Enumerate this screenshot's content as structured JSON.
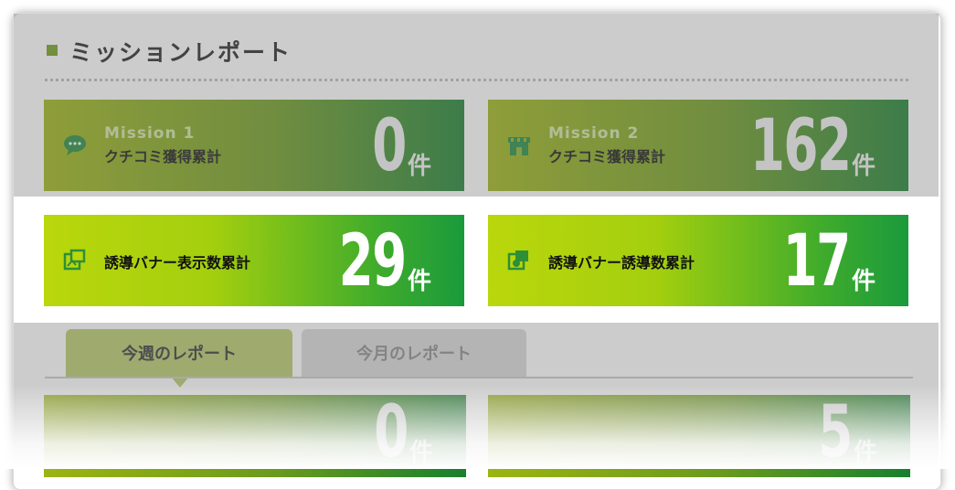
{
  "header": {
    "title": "ミッションレポート"
  },
  "missions": [
    {
      "label": "Mission 1",
      "sub": "クチコミ獲得累計",
      "value": "0",
      "unit": "件",
      "icon": "speech-bubble-icon"
    },
    {
      "label": "Mission 2",
      "sub": "クチコミ獲得累計",
      "value": "162",
      "unit": "件",
      "icon": "store-icon"
    }
  ],
  "banners": [
    {
      "sub": "誘導バナー表示数累計",
      "value": "29",
      "unit": "件",
      "icon": "banner-display-icon"
    },
    {
      "sub": "誘導バナー誘導数累計",
      "value": "17",
      "unit": "件",
      "icon": "banner-click-icon"
    }
  ],
  "tabs": [
    {
      "label": "今週のレポート",
      "active": true
    },
    {
      "label": "今月のレポート",
      "active": false
    }
  ],
  "lower": [
    {
      "value": "0",
      "unit": "件"
    },
    {
      "value": "5",
      "unit": "件"
    }
  ],
  "colors": {
    "accent": "#6f9e1a",
    "mission_gradient_start": "#9cb412",
    "mission_gradient_end": "#187f2e",
    "banner_gradient_start": "#bad70c",
    "banner_gradient_end": "#1a9a3c",
    "tab_active": "#b7c96a"
  }
}
